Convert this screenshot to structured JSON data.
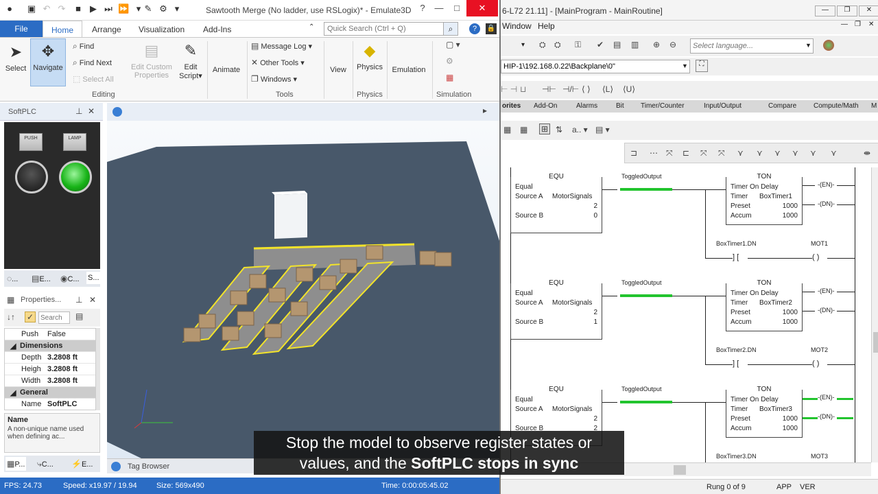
{
  "emulate3d": {
    "window_title": "Sawtooth Merge (No ladder, use RSLogix)* - Emulate3D",
    "tabs": {
      "file": "File",
      "home": "Home",
      "arrange": "Arrange",
      "visualization": "Visualization",
      "addins": "Add-Ins"
    },
    "quick_search_placeholder": "Quick Search (Ctrl + Q)",
    "ribbon": {
      "select": "Select",
      "navigate": "Navigate",
      "find": "Find",
      "find_next": "Find Next",
      "select_all": "Select All",
      "edit_custom": "Edit Custom",
      "properties": "Properties",
      "edit": "Edit",
      "script": "Script",
      "animate": "Animate",
      "message_log": "Message Log",
      "other_tools": "Other Tools",
      "windows": "Windows",
      "view": "View",
      "physics": "Physics",
      "emulation": "Emulation",
      "group_editing": "Editing",
      "group_tools": "Tools",
      "group_physics": "Physics",
      "group_simulation": "Simulation"
    },
    "softplc": {
      "title": "SoftPLC",
      "push_label": "PUSH",
      "lamp_label": "LAMP",
      "tabs": [
        "...",
        "E...",
        "C...",
        "S..."
      ]
    },
    "properties": {
      "title": "Properties...",
      "search_placeholder": "Search",
      "rows": [
        {
          "key": "Push",
          "value": "False"
        },
        {
          "key": "Dimensions",
          "value": ""
        },
        {
          "key": "Depth",
          "value": "3.2808 ft"
        },
        {
          "key": "Heigh",
          "value": "3.2808 ft"
        },
        {
          "key": "Width",
          "value": "3.2808 ft"
        },
        {
          "key": "General",
          "value": ""
        },
        {
          "key": "Name",
          "value": "SoftPLC"
        }
      ],
      "desc_name": "Name",
      "desc_text": "A non-unique name used when defining ac..."
    },
    "bottom_tabs": [
      "P...",
      "C...",
      "E..."
    ],
    "tag_browser": "Tag Browser",
    "status": {
      "fps": "FPS: 24.73",
      "speed": "Speed: x19.97 / 19.94",
      "size": "Size: 569x490",
      "time": "Time: 0:00:05:45.02"
    }
  },
  "studio5000": {
    "window_title": "6-L72 21.11] - [MainProgram - MainRoutine]",
    "menu": {
      "window": "Window",
      "help": "Help"
    },
    "language_placeholder": "Select language...",
    "path": "HIP-1\\192.168.0.22\\Backplane\\0\"",
    "instruction_tabs": [
      "orites",
      "Add-On",
      "Alarms",
      "Bit",
      "Timer/Counter",
      "Input/Output",
      "Compare",
      "Compute/Math",
      "M"
    ],
    "rungs": [
      {
        "equ_title": "EQU",
        "equ_name": "Equal",
        "source_a_label": "Source A",
        "source_a_tag": "MotorSignals",
        "source_a_value": "2",
        "source_b_label": "Source B",
        "source_b_value": "0",
        "contact_tag": "ToggledOutput",
        "ton_title": "TON",
        "ton_name": "Timer On Delay",
        "timer_label": "Timer",
        "timer_tag": "BoxTimer1",
        "preset_label": "Preset",
        "preset_value": "1000",
        "accum_label": "Accum",
        "accum_value": "1000",
        "en": "EN",
        "dn": "DN",
        "dn_tag": "BoxTimer1.DN",
        "coil_tag": "MOT1"
      },
      {
        "equ_title": "EQU",
        "equ_name": "Equal",
        "source_a_label": "Source A",
        "source_a_tag": "MotorSignals",
        "source_a_value": "2",
        "source_b_label": "Source B",
        "source_b_value": "1",
        "contact_tag": "ToggledOutput",
        "ton_title": "TON",
        "ton_name": "Timer On Delay",
        "timer_label": "Timer",
        "timer_tag": "BoxTimer2",
        "preset_label": "Preset",
        "preset_value": "1000",
        "accum_label": "Accum",
        "accum_value": "1000",
        "en": "EN",
        "dn": "DN",
        "dn_tag": "BoxTimer2.DN",
        "coil_tag": "MOT2"
      },
      {
        "equ_title": "EQU",
        "equ_name": "Equal",
        "source_a_label": "Source A",
        "source_a_tag": "MotorSignals",
        "source_a_value": "2",
        "source_b_label": "Source B",
        "source_b_value": "2",
        "contact_tag": "ToggledOutput",
        "ton_title": "TON",
        "ton_name": "Timer On Delay",
        "timer_label": "Timer",
        "timer_tag": "BoxTimer3",
        "preset_label": "Preset",
        "preset_value": "1000",
        "accum_label": "Accum",
        "accum_value": "1000",
        "en": "EN",
        "dn": "DN",
        "dn_tag": "BoxTimer3.DN",
        "coil_tag": "MOT3"
      }
    ],
    "status": {
      "rung": "Rung 0 of 9",
      "app": "APP",
      "ver": "VER"
    }
  },
  "caption": {
    "line1": "Stop the model to observe register states or",
    "line2a": "values, and the ",
    "line2b": "SoftPLC stops in sync"
  },
  "colors": {
    "accent_blue": "#2b6cc4",
    "energized_green": "#22c42e",
    "floor": "#48586a",
    "conveyor_edge": "#f2e32a"
  }
}
